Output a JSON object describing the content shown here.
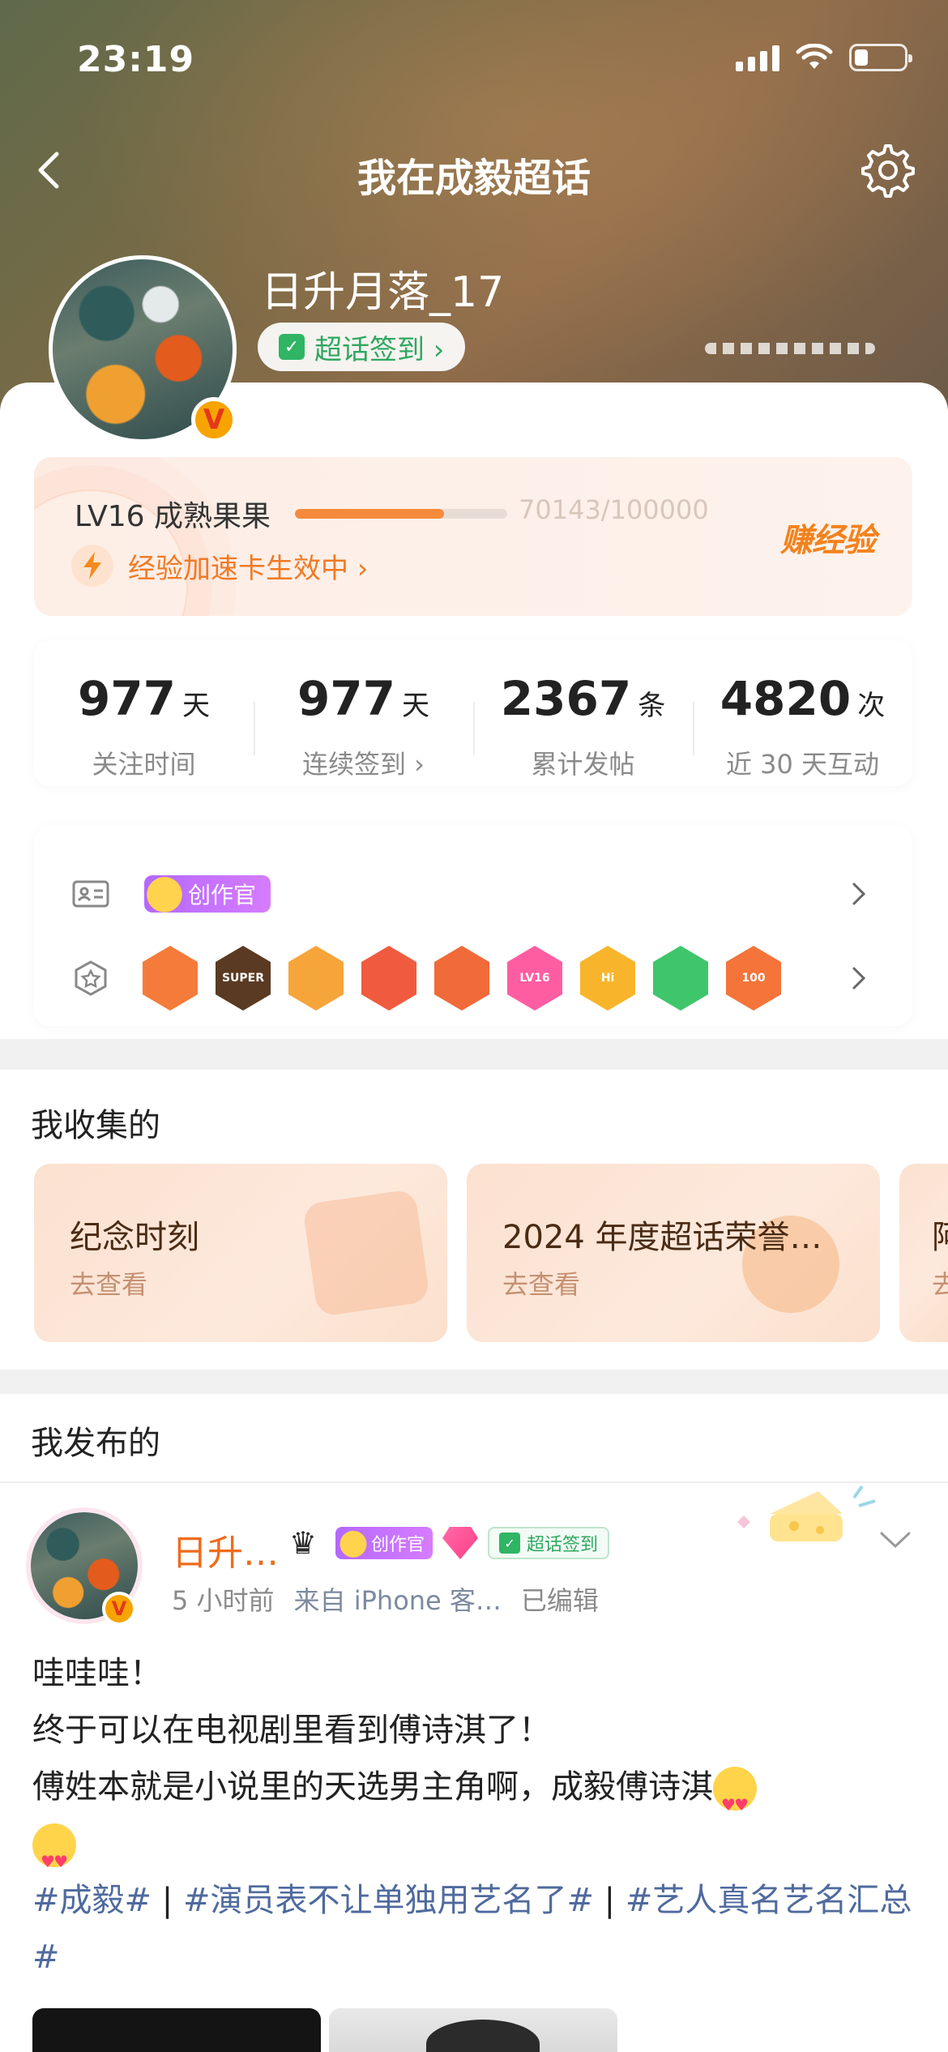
{
  "status_bar": {
    "time": "23:19"
  },
  "nav": {
    "title": "我在成毅超话"
  },
  "profile": {
    "username": "日升月落_17",
    "verified_badge": "V",
    "checkin_label": "超话签到 ›"
  },
  "level": {
    "name": "LV16 成熟果果",
    "progress_text": "70143/100000",
    "progress_fraction": 0.70143,
    "boost_text": "经验加速卡生效中 ›",
    "earn_label": "赚经验"
  },
  "stats": [
    {
      "value": "977",
      "unit": "天",
      "label": "关注时间"
    },
    {
      "value": "977",
      "unit": "天",
      "label": "连续签到 ›"
    },
    {
      "value": "2367",
      "unit": "条",
      "label": "累计发帖"
    },
    {
      "value": "4820",
      "unit": "次",
      "label": "近 30 天互动"
    }
  ],
  "badges": {
    "creator_tag": "创作官",
    "medals": [
      {
        "icon": "cat-medal",
        "color": "#f47b3a",
        "text": ""
      },
      {
        "icon": "super-crown-medal",
        "color": "#5a3a22",
        "text": "SUPER"
      },
      {
        "icon": "crown-medal",
        "color": "#f6a53a",
        "text": ""
      },
      {
        "icon": "girl-medal",
        "color": "#f05b3f",
        "text": ""
      },
      {
        "icon": "bunny-medal",
        "color": "#f06a3a",
        "text": ""
      },
      {
        "icon": "lv16-medal",
        "color": "#ff5da2",
        "text": "LV16"
      },
      {
        "icon": "hi-medal",
        "color": "#f8b52b",
        "text": "Hi"
      },
      {
        "icon": "hand-medal",
        "color": "#3fc66a",
        "text": ""
      },
      {
        "icon": "100-days-medal",
        "color": "#f4743a",
        "text": "100"
      }
    ]
  },
  "collection": {
    "title": "我收集的",
    "cards": [
      {
        "title": "纪念时刻",
        "action": "去查看"
      },
      {
        "title": "2024 年度超话荣誉…",
        "action": "去查看"
      },
      {
        "title": "阿",
        "action": "去"
      }
    ]
  },
  "posts": {
    "title": "我发布的",
    "item": {
      "name": "日升…",
      "creator_tag": "创作官",
      "checkin_tag": "超话签到",
      "time": "5 小时前",
      "source": "来自 iPhone 客…",
      "edited": "已编辑",
      "line1": "哇哇哇！",
      "line2": "终于可以在电视剧里看到傅诗淇了！",
      "line3": "傅姓本就是小说里的天选男主角啊，成毅傅诗淇",
      "hashtag1": "#成毅#",
      "sep1": " | ",
      "hashtag2": "#演员表不让单独用艺名了#",
      "sep2": " | ",
      "hashtag3": "#艺人真名艺名汇总#"
    }
  }
}
